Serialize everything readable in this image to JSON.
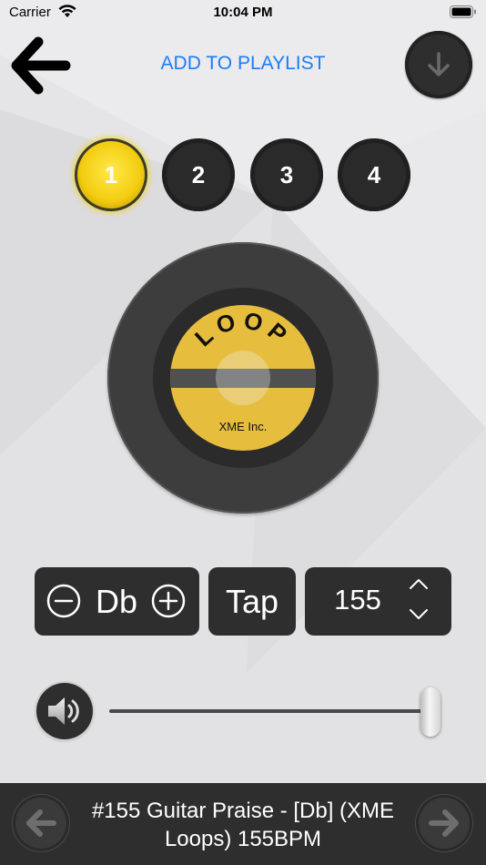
{
  "status_bar": {
    "carrier": "Carrier",
    "time": "10:04 PM"
  },
  "header": {
    "add_to_playlist": "ADD TO PLAYLIST"
  },
  "slots": [
    {
      "label": "1",
      "active": true
    },
    {
      "label": "2",
      "active": false
    },
    {
      "label": "3",
      "active": false
    },
    {
      "label": "4",
      "active": false
    }
  ],
  "record": {
    "label_title": "LOOP",
    "label_company": "XME Inc."
  },
  "controls": {
    "key": "Db",
    "tap": "Tap",
    "bpm": "155"
  },
  "volume": {
    "level": 0.98
  },
  "now_playing": {
    "title": "#155 Guitar Praise - [Db] (XME Loops) 155BPM"
  },
  "colors": {
    "accent": "#1b7cf6",
    "active_slot": "#f3cc10",
    "label": "#e7bd3e",
    "panel": "#2e2e2e"
  },
  "icons": {
    "back": "arrow-left-icon",
    "download": "arrow-down-icon",
    "minus": "minus-circle-icon",
    "plus": "plus-circle-icon",
    "up": "chevron-up-icon",
    "down": "chevron-down-icon",
    "volume": "speaker-icon",
    "prev": "arrow-left-icon",
    "next": "arrow-right-icon"
  }
}
